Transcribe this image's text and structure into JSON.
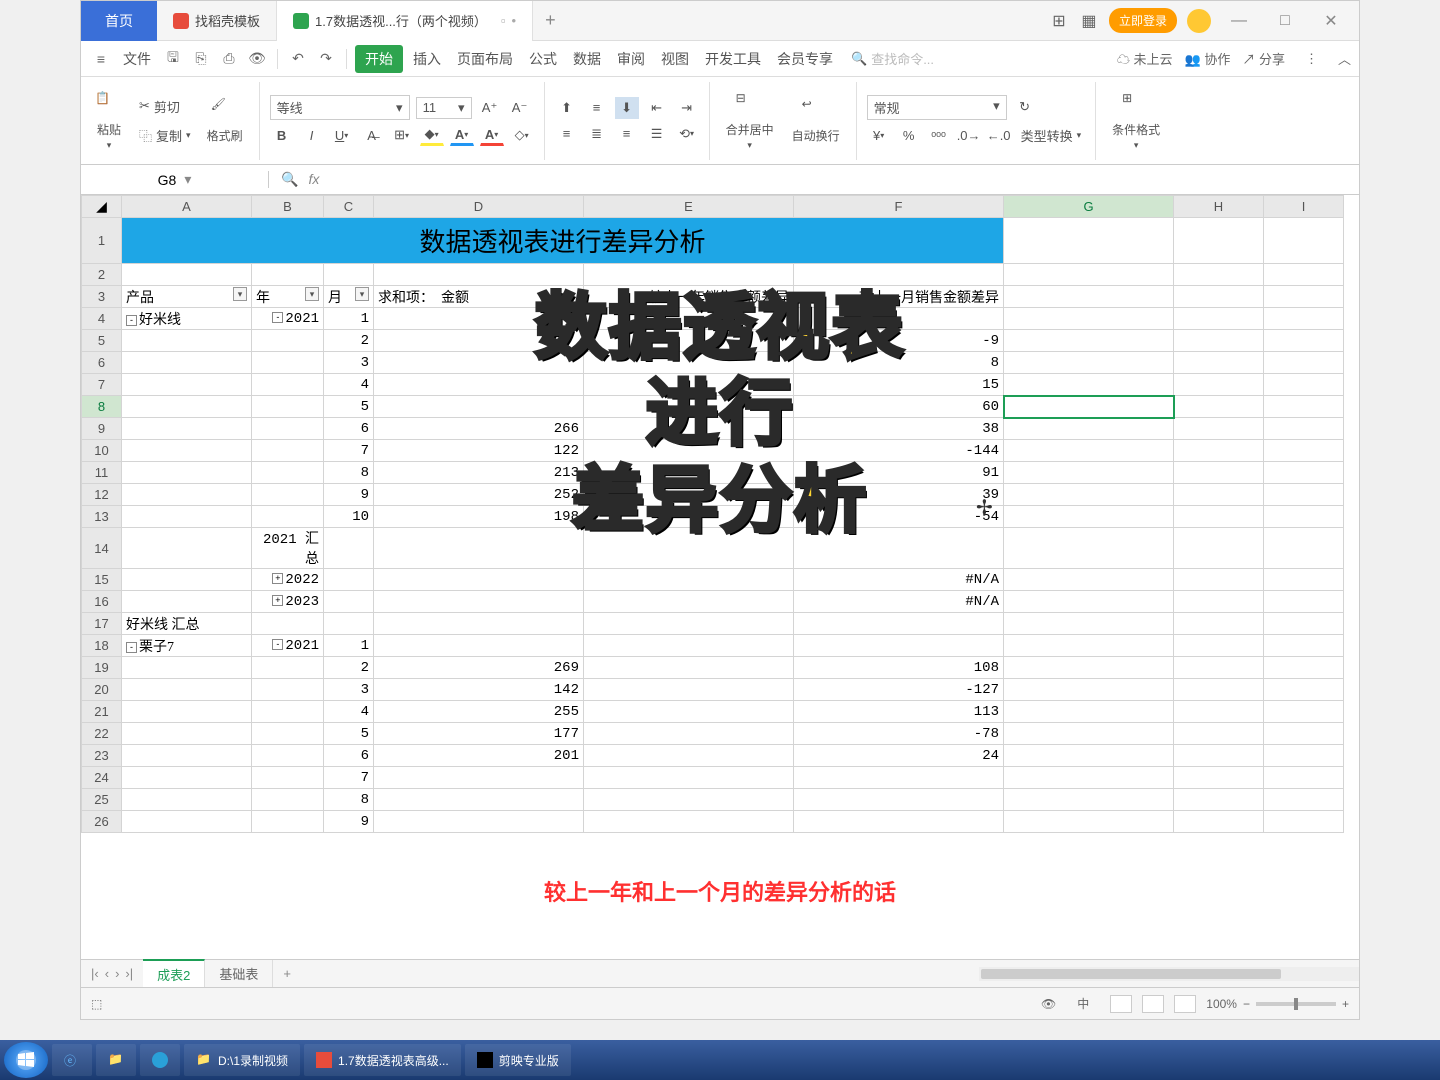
{
  "titlebar": {
    "home": "首页",
    "tab1": "找稻壳模板",
    "tab2": "1.7数据透视...行（两个视频）",
    "login": "立即登录"
  },
  "menu": {
    "file": "文件",
    "start": "开始",
    "insert": "插入",
    "layout": "页面布局",
    "formula": "公式",
    "data": "数据",
    "review": "审阅",
    "view": "视图",
    "dev": "开发工具",
    "vip": "会员专享",
    "search_ph": "查找命令...",
    "cloud": "未上云",
    "collab": "协作",
    "share": "分享"
  },
  "ribbon": {
    "paste": "粘贴",
    "cut": "剪切",
    "copy": "复制",
    "brush": "格式刷",
    "font": "等线",
    "size": "11",
    "merge": "合并居中",
    "wrap": "自动换行",
    "numfmt": "常规",
    "typeconv": "类型转换",
    "condfmt": "条件格式"
  },
  "namebox": "G8",
  "cols": [
    "A",
    "B",
    "C",
    "D",
    "E",
    "F",
    "G",
    "H",
    "I"
  ],
  "title_cell": "数据透视表进行差异分析",
  "headers": {
    "product": "产品",
    "year": "年",
    "month": "月",
    "sum": "求和项：",
    "amount": "金额",
    "ydiff": "较上一年销售金额差异",
    "mdiff": "较上一月销售金额差异"
  },
  "rows": [
    {
      "r": 4,
      "A": "好米线",
      "Aexp": "-",
      "B": "2021",
      "Bexp": "-",
      "C": "1"
    },
    {
      "r": 5,
      "C": "2",
      "F": "-9"
    },
    {
      "r": 6,
      "C": "3",
      "F": "8"
    },
    {
      "r": 7,
      "C": "4",
      "F": "15"
    },
    {
      "r": 8,
      "C": "5",
      "F": "60"
    },
    {
      "r": 9,
      "C": "6",
      "D": "266",
      "F": "38"
    },
    {
      "r": 10,
      "C": "7",
      "D": "122",
      "F": "-144"
    },
    {
      "r": 11,
      "C": "8",
      "D": "213",
      "F": "91"
    },
    {
      "r": 12,
      "C": "9",
      "D": "252",
      "F": "39"
    },
    {
      "r": 13,
      "C": "10",
      "D": "198",
      "F": "-54"
    },
    {
      "r": 14,
      "B": "2021 汇总"
    },
    {
      "r": 15,
      "B": "2022",
      "Bexp": "+",
      "F": "#N/A"
    },
    {
      "r": 16,
      "B": "2023",
      "Bexp": "+",
      "F": "#N/A"
    },
    {
      "r": 17,
      "A": "好米线 汇总"
    },
    {
      "r": 18,
      "A": "栗子7",
      "Aexp": "-",
      "B": "2021",
      "Bexp": "-",
      "C": "1"
    },
    {
      "r": 19,
      "C": "2",
      "D": "269",
      "F": "108"
    },
    {
      "r": 20,
      "C": "3",
      "D": "142",
      "F": "-127"
    },
    {
      "r": 21,
      "C": "4",
      "D": "255",
      "F": "113"
    },
    {
      "r": 22,
      "C": "5",
      "D": "177",
      "F": "-78"
    },
    {
      "r": 23,
      "C": "6",
      "D": "201",
      "F": "24"
    },
    {
      "r": 24,
      "C": "7"
    },
    {
      "r": 25,
      "C": "8"
    },
    {
      "r": 26,
      "C": "9"
    }
  ],
  "overlay": {
    "l1": "数据透视表",
    "l2": "进行",
    "l3": "差异分析"
  },
  "subtitle": "较上一年和上一个月的差异分析的话",
  "sheets": {
    "s1": "成表2",
    "s2": "基础表"
  },
  "zoom": "100%",
  "taskbar": {
    "t1": "D:\\1录制视频",
    "t2": "1.7数据透视表高级...",
    "t3": "剪映专业版"
  }
}
